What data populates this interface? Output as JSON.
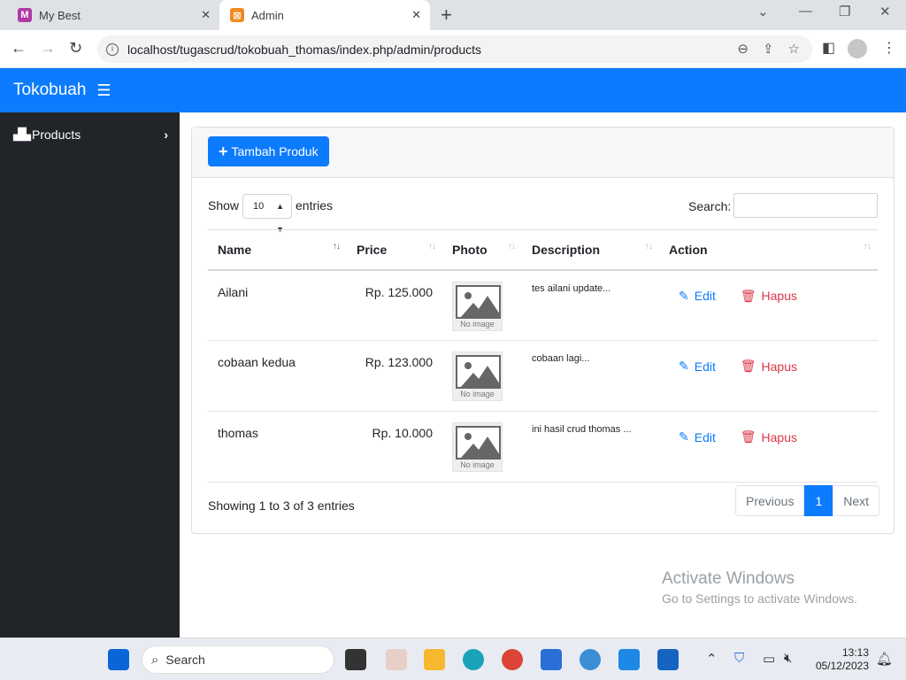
{
  "browser": {
    "tabs": [
      {
        "title": "My Best",
        "active": false
      },
      {
        "title": "Admin",
        "active": true
      }
    ],
    "url": "localhost/tugascrud/tokobuah_thomas/index.php/admin/products"
  },
  "navbar": {
    "brand": "Tokobuah"
  },
  "sidebar": {
    "items": [
      {
        "label": "Products",
        "icon": "boxes-icon"
      }
    ]
  },
  "toolbar": {
    "add_label": "Tambah Produk"
  },
  "table_controls": {
    "show_label": "Show",
    "entries_value": "10",
    "entries_label": "entries",
    "search_label": "Search:",
    "search_value": ""
  },
  "table": {
    "columns": [
      "Name",
      "Price",
      "Photo",
      "Description",
      "Action"
    ],
    "rows": [
      {
        "name": "Ailani",
        "price": "Rp. 125.000",
        "photo_caption": "No image",
        "description": "tes ailani update...",
        "edit": "Edit",
        "delete": "Hapus"
      },
      {
        "name": "cobaan kedua",
        "price": "Rp. 123.000",
        "photo_caption": "No image",
        "description": "cobaan lagi...",
        "edit": "Edit",
        "delete": "Hapus"
      },
      {
        "name": "thomas",
        "price": "Rp. 10.000",
        "photo_caption": "No image",
        "description": "ini hasil crud thomas ...",
        "edit": "Edit",
        "delete": "Hapus"
      }
    ]
  },
  "footer": {
    "info": "Showing 1 to 3 of 3 entries",
    "prev": "Previous",
    "page": "1",
    "next": "Next"
  },
  "watermark": {
    "title": "Activate Windows",
    "subtitle": "Go to Settings to activate Windows."
  },
  "taskbar": {
    "search_placeholder": "Search",
    "time": "13:13",
    "date": "05/12/2023"
  },
  "colors": {
    "primary": "#0d7bfd",
    "sidebar": "#212529",
    "danger": "#dc3545"
  }
}
